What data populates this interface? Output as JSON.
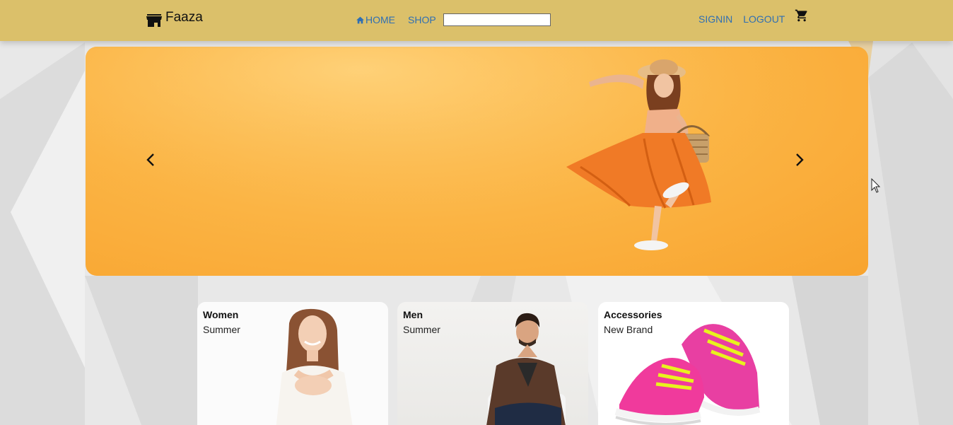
{
  "brand": {
    "name": "Faaza",
    "icon": "store-icon"
  },
  "nav": {
    "home_label": "HOME",
    "home_icon": "home-icon",
    "shop_label": "SHOP",
    "search_value": "",
    "signin_label": "SIGNIN",
    "logout_label": "LOGOUT",
    "cart_icon": "cart-icon"
  },
  "hero": {
    "prev_icon": "chevron-left-icon",
    "next_icon": "chevron-right-icon",
    "image": "woman-orange-dress"
  },
  "categories": [
    {
      "title": "Women",
      "subtitle": "Summer",
      "image": "smiling-woman"
    },
    {
      "title": "Men",
      "subtitle": "Summer",
      "image": "seated-man"
    },
    {
      "title": "Accessories",
      "subtitle": "New Brand",
      "image": "pink-sneakers"
    }
  ],
  "colors": {
    "navbar": "#dbc06a",
    "link": "#2f6fb3",
    "hero": "#fbb444"
  }
}
